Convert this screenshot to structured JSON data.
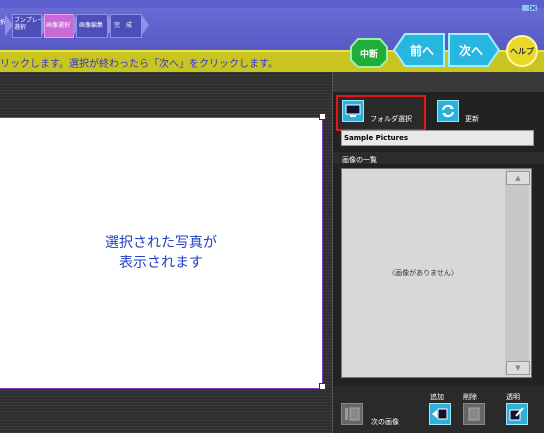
{
  "steps": [
    {
      "label": "ブンプレート\n選択"
    },
    {
      "label": "画像選択"
    },
    {
      "label": "画像編集"
    },
    {
      "label": "完　成"
    }
  ],
  "step_prefix": "択",
  "instruction": "リックします。選択が終わったら「次へ」をクリックします。",
  "nav": {
    "stop": "中断",
    "prev": "前へ",
    "next": "次へ",
    "help": "ヘルプ"
  },
  "preview": {
    "line1": "選択された写真が",
    "line2": "表示されます"
  },
  "panel": {
    "folder_select": "フォルダ選択",
    "refresh": "更新",
    "folder_value": "Sample Pictures",
    "list_title": "画像の一覧",
    "empty": "〈画像がありません〉",
    "next_image": "次の画像",
    "add": "追加",
    "delete": "削除",
    "transparent": "透明"
  },
  "colors": {
    "header": "#6d6fd9",
    "yellow_bar": "#c8c520",
    "nav_green": "#1fae3a",
    "nav_cyan": "#27b6e0",
    "help_yellow": "#e8d82a",
    "highlight": "#e01818"
  }
}
